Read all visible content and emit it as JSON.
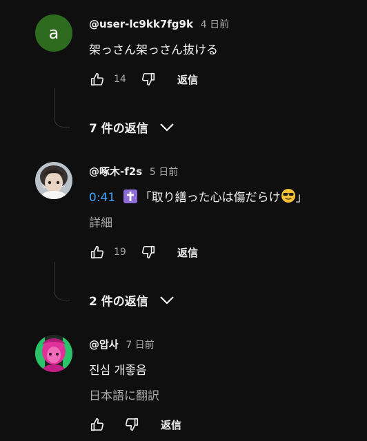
{
  "comments": [
    {
      "author": "@user-lc9kk7fg9k",
      "time": "4 日前",
      "avatar_letter": "a",
      "avatar_color": "#2e6b1f",
      "text": "架っさん架っさん抜ける",
      "likes": "14",
      "reply_label": "返信",
      "replies_toggle": "7 件の返信"
    },
    {
      "author": "@啄木-f2s",
      "time": "5 日前",
      "timestamp": "0:41",
      "emoji_cross": "latin-cross-emoji",
      "text": "「取り繕った心は傷だらけ",
      "emoji_face": "sunglasses-face-emoji",
      "text_end": "」",
      "more_label": "詳細",
      "likes": "19",
      "reply_label": "返信",
      "replies_toggle": "2 件の返信"
    },
    {
      "author": "@압사",
      "time": "7 日前",
      "text": "진심 개좋음",
      "translate_label": "日本語に翻訳",
      "likes": "",
      "reply_label": "返信"
    }
  ],
  "icons": {
    "like": "thumbs-up-icon",
    "dislike": "thumbs-down-icon",
    "chevron": "chevron-down-icon"
  },
  "colors": {
    "background": "#0f0f0f",
    "text": "#f1f1f1",
    "secondary_text": "#aaaaaa",
    "link": "#3ea6ff"
  }
}
